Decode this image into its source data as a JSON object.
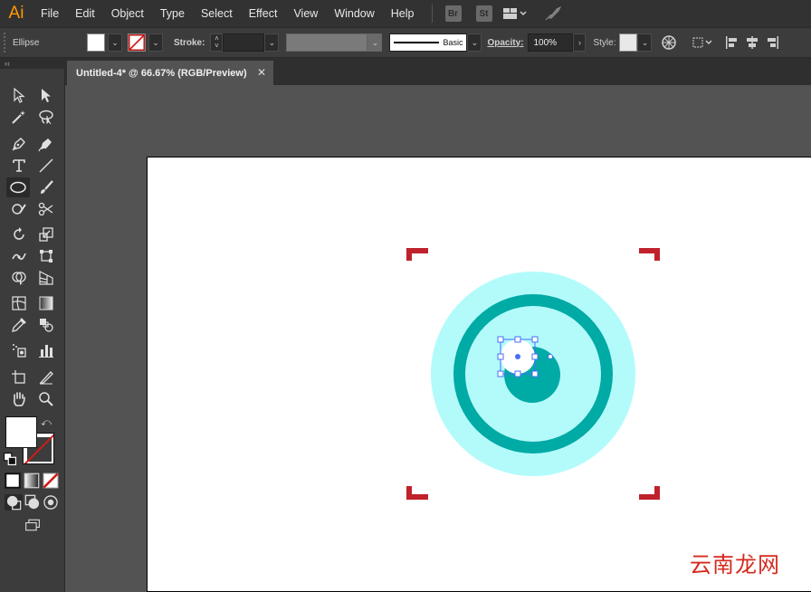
{
  "app": {
    "logo": "Ai"
  },
  "menu": [
    "File",
    "Edit",
    "Object",
    "Type",
    "Select",
    "Effect",
    "View",
    "Window",
    "Help"
  ],
  "menu_icons": {
    "bridge": "Br",
    "stock": "St"
  },
  "control": {
    "selection_label": "Ellipse",
    "fill_color": "#ffffff",
    "stroke_label": "Stroke:",
    "stroke_profile": "Basic",
    "opacity_label": "Opacity:",
    "opacity_value": "100%",
    "style_label": "Style:"
  },
  "document": {
    "tab_title": "Untitled-4* @ 66.67% (RGB/Preview)",
    "close_glyph": "✕"
  },
  "artwork": {
    "outer_ring_color": "#b3fbfb",
    "middle_ring_color": "#00aaa5",
    "inner_color": "#b3fbfb",
    "pupil_color": "#00aaa5",
    "highlight_color": "#ffffff",
    "crop_mark_color": "#c0222b",
    "selection_color": "#4a6cf7"
  },
  "watermark": "云南龙网"
}
